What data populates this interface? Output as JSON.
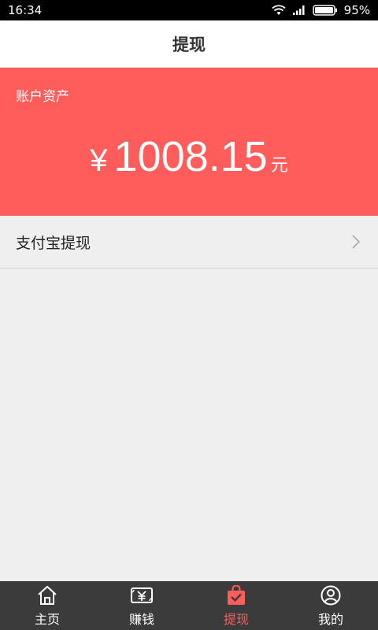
{
  "status_bar": {
    "time": "16:34",
    "battery_percent": "95%",
    "icons": [
      "wifi-icon",
      "signal-icon",
      "battery-icon"
    ]
  },
  "header": {
    "title": "提现"
  },
  "assets": {
    "label": "账户资产",
    "currency": "¥",
    "amount": "1008.15",
    "unit": "元",
    "background_color": "#ff5c5c"
  },
  "withdraw_options": [
    {
      "label": "支付宝提现",
      "icon": "chevron-right-icon"
    }
  ],
  "tab_bar": {
    "tabs": [
      {
        "label": "主页",
        "icon": "home-icon",
        "active": false
      },
      {
        "label": "赚钱",
        "icon": "money-icon",
        "active": false
      },
      {
        "label": "提现",
        "icon": "bag-check-icon",
        "active": true
      },
      {
        "label": "我的",
        "icon": "user-icon",
        "active": false
      }
    ],
    "active_color": "#ff5c5c"
  }
}
